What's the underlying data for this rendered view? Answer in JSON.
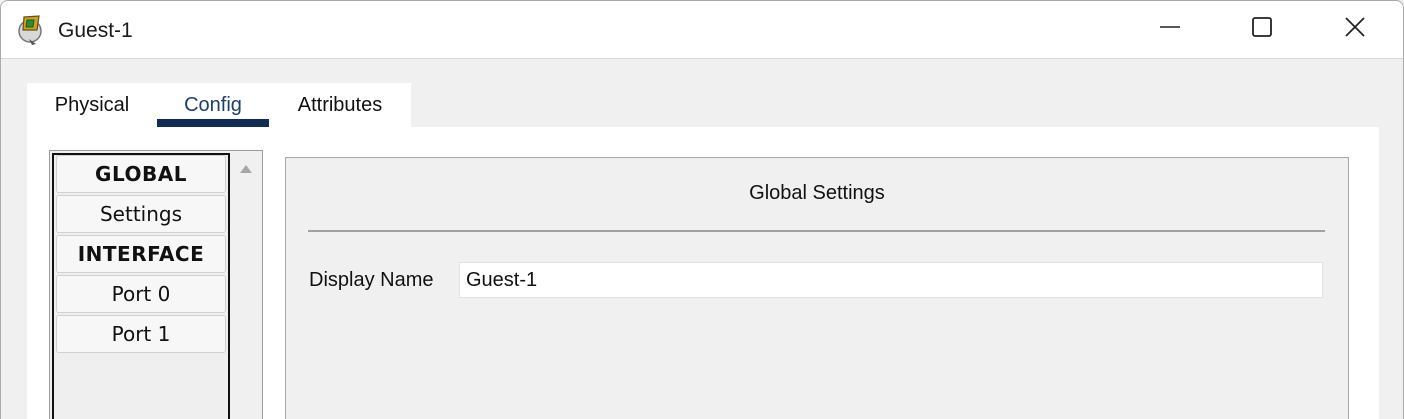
{
  "window": {
    "title": "Guest-1",
    "icon": "packet-tracer-device-icon",
    "controls": [
      "minimize-icon",
      "maximize-icon",
      "close-icon"
    ]
  },
  "tabs": [
    {
      "label": "Physical",
      "active": false
    },
    {
      "label": "Config",
      "active": true
    },
    {
      "label": "Attributes",
      "active": false
    }
  ],
  "sidebar": {
    "items": [
      {
        "label": "GLOBAL",
        "type": "header"
      },
      {
        "label": "Settings",
        "type": "item"
      },
      {
        "label": "INTERFACE",
        "type": "header"
      },
      {
        "label": "Port 0",
        "type": "item"
      },
      {
        "label": "Port 1",
        "type": "item"
      }
    ]
  },
  "main": {
    "section_title": "Global Settings",
    "display_name_label": "Display Name",
    "display_name_value": "Guest-1"
  },
  "colors": {
    "active_tab_underline": "#0f2d57",
    "active_tab_text": "#1c3f6e",
    "panel_background": "#f0f0f0"
  }
}
